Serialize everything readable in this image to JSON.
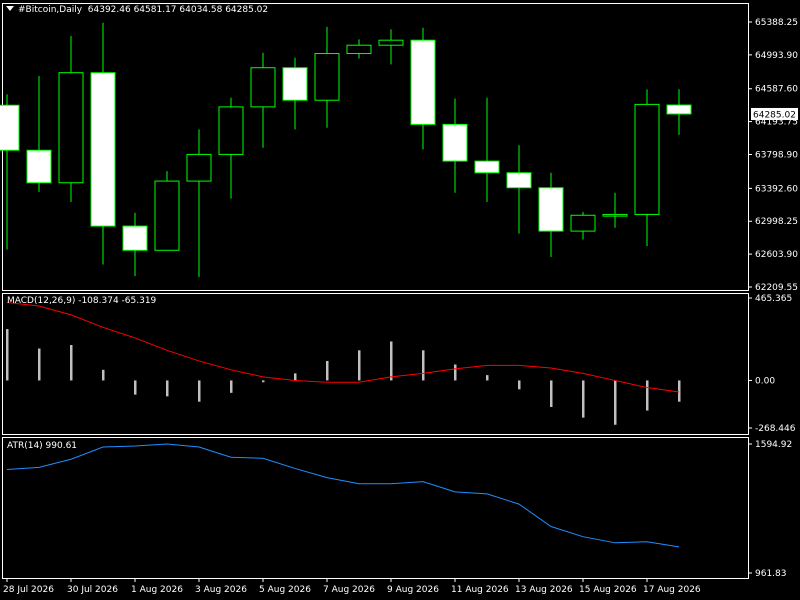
{
  "main": {
    "symbol": "#Bitcoin,Daily",
    "ohlc": "64392.46 64581.17 64034.58 64285.02",
    "last_price": "64285.02",
    "y_ticks": [
      "65388.25",
      "64993.90",
      "64587.60",
      "64193.75",
      "63798.90",
      "63392.60",
      "62998.25",
      "62603.90",
      "62209.55"
    ],
    "y_range": [
      62209.55,
      65388.25
    ]
  },
  "macd": {
    "label": "MACD(12,26,9) -108.374 -65.319",
    "y_ticks": [
      "465.365",
      "0.00",
      "-268.446"
    ],
    "y_range": [
      -268.446,
      465.365
    ]
  },
  "atr": {
    "label": "ATR(14) 990.61",
    "y_ticks": [
      "1594.92",
      "961.83"
    ],
    "y_range": [
      961.83,
      1594.92
    ]
  },
  "x_labels": [
    "28 Jul 2026",
    "30 Jul 2026",
    "1 Aug 2026",
    "3 Aug 2026",
    "5 Aug 2026",
    "7 Aug 2026",
    "9 Aug 2026",
    "11 Aug 2026",
    "13 Aug 2026",
    "15 Aug 2026",
    "17 Aug 2026"
  ],
  "colors": {
    "candle_up_body": "#000000",
    "candle_down_body": "#ffffff",
    "candle_outline": "#00ff00",
    "macd_hist": "#c0c0c0",
    "macd_signal": "#ff0000",
    "atr_line": "#1e90ff",
    "grid_frame": "#ffffff"
  },
  "chart_data": [
    {
      "type": "candlestick",
      "title": "#Bitcoin,Daily",
      "ylim": [
        62209.55,
        65388.25
      ],
      "candles": [
        {
          "o": 64390,
          "h": 64520,
          "l": 62660,
          "c": 63850
        },
        {
          "o": 63850,
          "h": 64740,
          "l": 63350,
          "c": 63460
        },
        {
          "o": 63460,
          "h": 65220,
          "l": 63230,
          "c": 64780
        },
        {
          "o": 64780,
          "h": 65380,
          "l": 62480,
          "c": 62940
        },
        {
          "o": 62940,
          "h": 63100,
          "l": 62340,
          "c": 62650
        },
        {
          "o": 62650,
          "h": 63600,
          "l": 62680,
          "c": 63480
        },
        {
          "o": 63480,
          "h": 64100,
          "l": 62330,
          "c": 63800
        },
        {
          "o": 63800,
          "h": 64480,
          "l": 63270,
          "c": 64370
        },
        {
          "o": 64370,
          "h": 65020,
          "l": 63880,
          "c": 64840
        },
        {
          "o": 64840,
          "h": 64960,
          "l": 64100,
          "c": 64450
        },
        {
          "o": 64450,
          "h": 65330,
          "l": 64120,
          "c": 65010
        },
        {
          "o": 65010,
          "h": 65180,
          "l": 64950,
          "c": 65110
        },
        {
          "o": 65110,
          "h": 65300,
          "l": 64880,
          "c": 65170
        },
        {
          "o": 65170,
          "h": 65320,
          "l": 63860,
          "c": 64160
        },
        {
          "o": 64160,
          "h": 64470,
          "l": 63340,
          "c": 63720
        },
        {
          "o": 63720,
          "h": 64480,
          "l": 63230,
          "c": 63580
        },
        {
          "o": 63580,
          "h": 63910,
          "l": 62850,
          "c": 63400
        },
        {
          "o": 63400,
          "h": 63580,
          "l": 62570,
          "c": 62880
        },
        {
          "o": 62880,
          "h": 63110,
          "l": 62780,
          "c": 63070
        },
        {
          "o": 63060,
          "h": 63340,
          "l": 62920,
          "c": 63080
        },
        {
          "o": 63080,
          "h": 64580,
          "l": 62700,
          "c": 64400
        },
        {
          "o": 64392.46,
          "h": 64581.17,
          "l": 64034.58,
          "c": 64285.02
        }
      ]
    },
    {
      "type": "bar+line",
      "title": "MACD(12,26,9) -108.374 -65.319",
      "ylim": [
        -268.446,
        465.365
      ],
      "histogram": [
        290,
        180,
        200,
        60,
        -80,
        -90,
        -120,
        -70,
        -10,
        40,
        110,
        170,
        220,
        170,
        90,
        30,
        -50,
        -150,
        -210,
        -250,
        -170,
        -120
      ],
      "signal": [
        440,
        420,
        370,
        300,
        240,
        170,
        110,
        60,
        20,
        0,
        -10,
        -10,
        20,
        40,
        65,
        85,
        85,
        70,
        40,
        0,
        -40,
        -65
      ]
    },
    {
      "type": "line",
      "title": "ATR(14) 990.61",
      "ylim": [
        961.83,
        1594.92
      ],
      "values": [
        1470,
        1480,
        1520,
        1580,
        1585,
        1595,
        1580,
        1530,
        1525,
        1475,
        1430,
        1400,
        1400,
        1410,
        1360,
        1350,
        1300,
        1190,
        1140,
        1110,
        1115,
        1090
      ]
    }
  ]
}
